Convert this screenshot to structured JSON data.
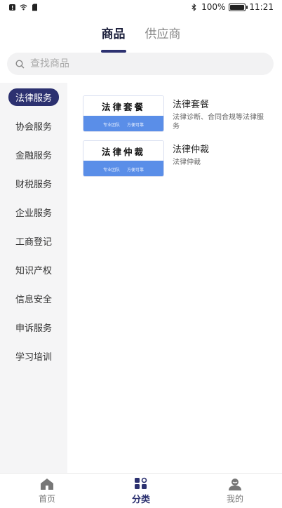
{
  "status_bar": {
    "battery_percent": "100%",
    "time": "11:21",
    "icons": [
      "notification-icon",
      "wifi-icon",
      "sim-icon",
      "bluetooth-icon",
      "battery-icon"
    ],
    "battery_level": 1.0
  },
  "top_tabs": [
    {
      "label": "商品",
      "active": true
    },
    {
      "label": "供应商",
      "active": false
    }
  ],
  "search": {
    "placeholder": "查找商品",
    "icon": "search-icon"
  },
  "sidebar": {
    "items": [
      {
        "label": "法律服务",
        "active": true
      },
      {
        "label": "协会服务"
      },
      {
        "label": "金融服务"
      },
      {
        "label": "财税服务"
      },
      {
        "label": "企业服务"
      },
      {
        "label": "工商登记"
      },
      {
        "label": "知识产权"
      },
      {
        "label": "信息安全"
      },
      {
        "label": "申诉服务"
      },
      {
        "label": "学习培训"
      }
    ]
  },
  "products": [
    {
      "thumb_title": "法律套餐",
      "thumb_tag1": "专业团队",
      "thumb_tag2": "方便可靠",
      "title": "法律套餐",
      "desc": "法律诊断、合同合规等法律服务"
    },
    {
      "thumb_title": "法律仲裁",
      "thumb_tag1": "专业团队",
      "thumb_tag2": "方便可靠",
      "title": "法律仲裁",
      "desc": "法律仲裁"
    }
  ],
  "bottom_nav": [
    {
      "label": "首页",
      "icon": "home-icon",
      "active": false
    },
    {
      "label": "分类",
      "icon": "category-icon",
      "active": true
    },
    {
      "label": "我的",
      "icon": "profile-icon",
      "active": false
    }
  ],
  "colors": {
    "accent": "#2c3170",
    "thumb_blue": "#5a8ee8",
    "sidebar_bg": "#f5f5f6"
  }
}
